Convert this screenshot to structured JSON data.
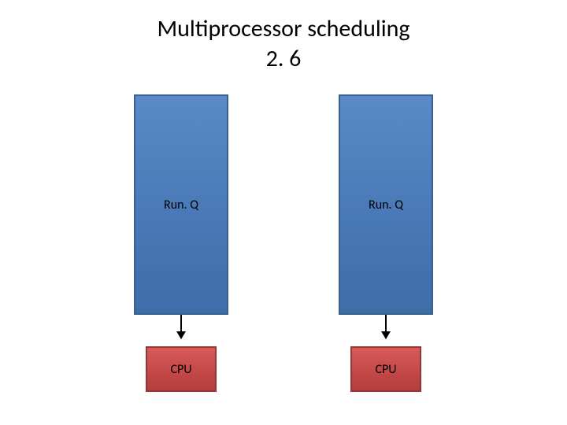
{
  "title_line1": "Multiprocessor scheduling",
  "title_line2": "2. 6",
  "columns": [
    {
      "queue_label": "Run. Q",
      "cpu_label": "CPU"
    },
    {
      "queue_label": "Run. Q",
      "cpu_label": "CPU"
    }
  ],
  "colors": {
    "queue_fill": "#4a7bb8",
    "queue_border": "#395f93",
    "cpu_fill": "#c24746",
    "cpu_border": "#933634"
  }
}
